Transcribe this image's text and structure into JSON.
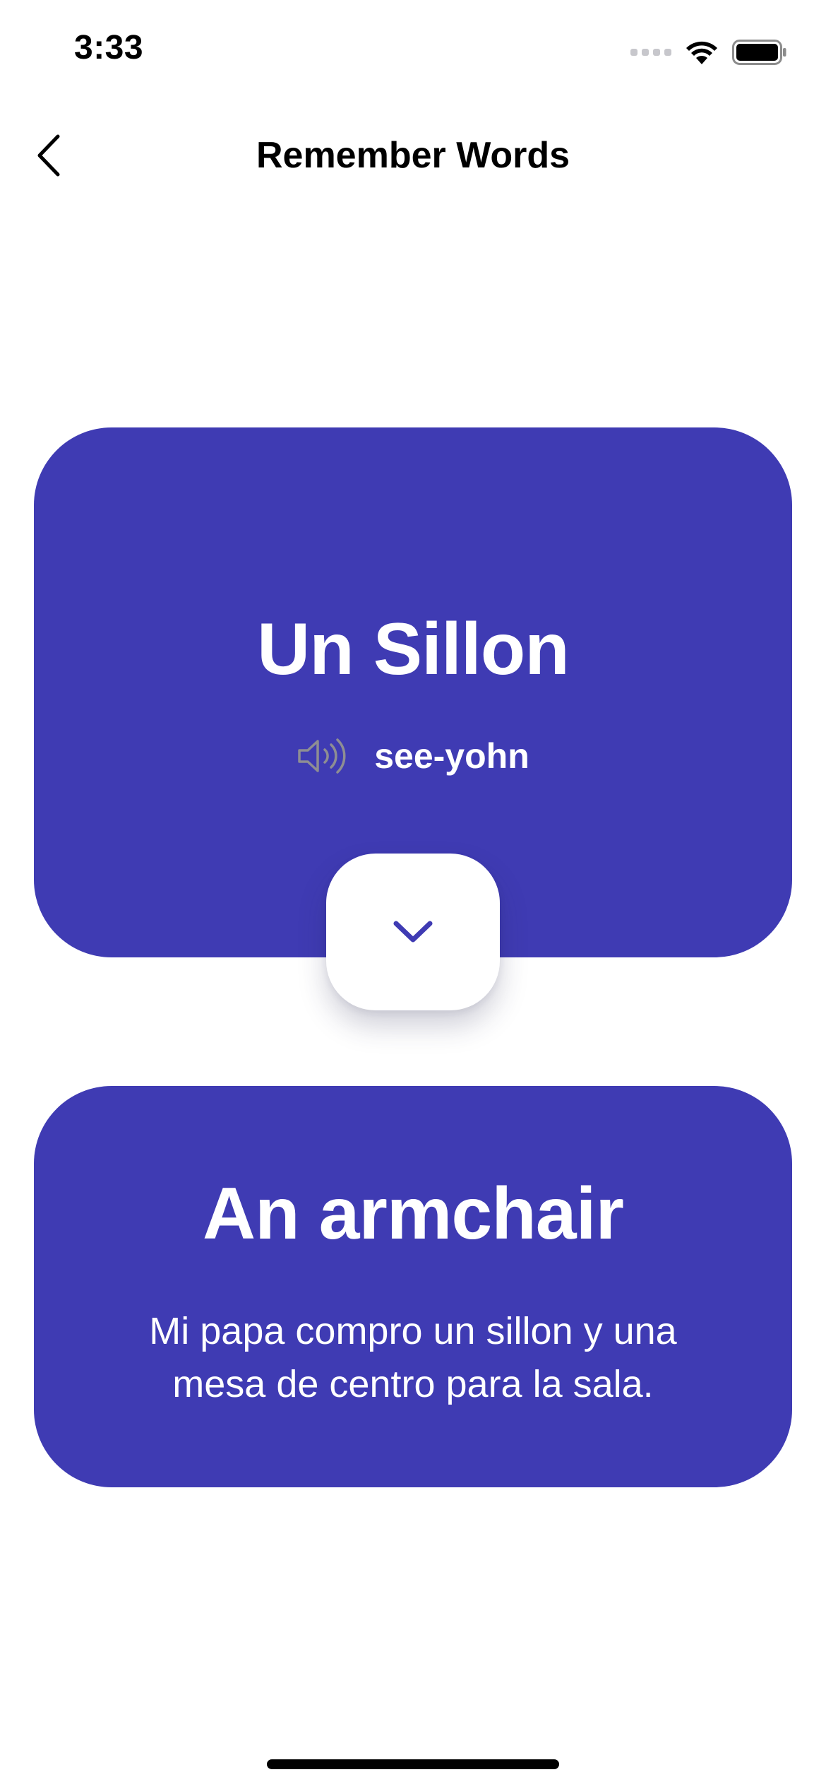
{
  "status_bar": {
    "time": "3:33",
    "icons": [
      "signal-dots-icon",
      "wifi-icon",
      "battery-icon"
    ]
  },
  "nav": {
    "back_icon": "chevron-left-icon",
    "title": "Remember Words"
  },
  "word_card": {
    "word": "Un Sillon",
    "speaker_icon": "speaker-icon",
    "phonetic": "see-yohn"
  },
  "flip_button": {
    "icon": "chevron-down-icon"
  },
  "meaning_card": {
    "translation": "An armchair",
    "example": "Mi papa compro un sillon y una mesa de centro para la sala."
  },
  "colors": {
    "card_background": "#3f3bb3",
    "card_text": "#ffffff",
    "accent": "#3f3bb3",
    "speaker_icon": "#8e8e93"
  }
}
